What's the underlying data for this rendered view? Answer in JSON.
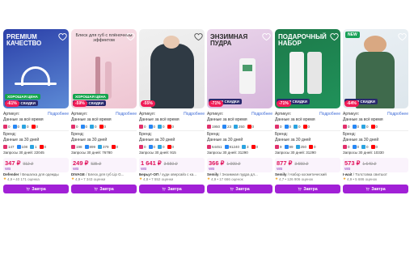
{
  "labels": {
    "article": "Артикул:",
    "more": "Подробнее",
    "all_time": "Данные за всё время",
    "brand": "Бренд:",
    "data30": "Данные за 30 дней",
    "buy": "Завтра"
  },
  "cards": [
    {
      "overlay": "PREMIUM КАЧЕСТВО",
      "discount": "-61%",
      "ribbons": [
        "ХОРОШАЯ ЦЕНА",
        "КИБЕР СКИДКИ"
      ],
      "stats_all": [
        "0",
        "0",
        "0",
        "0"
      ],
      "stats_30": [
        "147",
        "108",
        "1",
        "0"
      ],
      "requests": "Запросы 30 дней: 22045",
      "price": "347 ₽",
      "old_price": "912 ₽",
      "wb": "WB",
      "brand": "Defender",
      "name": "/ Вешалка для одежды",
      "rating": "4,9",
      "reviews": "• 40 171 оценка",
      "colors": [
        "#2b3fa8",
        "#5d8bd6"
      ]
    },
    {
      "overlay": "Блеск для губ с плёночным эффектом",
      "discount": "-59%",
      "ribbons": [
        "ХОРОШАЯ ЦЕНА",
        "КИБЕР СКИДКИ"
      ],
      "stats_all": [
        "0",
        "0",
        "0",
        "0"
      ],
      "stats_30": [
        "198",
        "899",
        "379",
        "0"
      ],
      "requests": "Запросы 30 дней: 76780",
      "price": "249 ₽",
      "old_price": "535 ₽",
      "wb": "WB",
      "brand": "DIVAGE",
      "name": "/ Блеск для губ Lip G...",
      "rating": "4,9",
      "reviews": "• 7 343 оценки",
      "colors": [
        "#f7dfe6",
        "#eec5d2"
      ]
    },
    {
      "overlay": "",
      "discount": "-55%",
      "ribbons": [],
      "stats_all": [
        "0",
        "0",
        "0",
        "0"
      ],
      "stats_30": [
        "0",
        "0",
        "0",
        "0"
      ],
      "requests": "Запросы 30 дней: 915",
      "price": "1 641 ₽",
      "old_price": "3 550 ₽",
      "wb": "WB",
      "brand": "Берьут-ОП",
      "name": "/ худи оверсайз с ка...",
      "rating": "4,8",
      "reviews": "• 7 552 оценки",
      "colors": [
        "#f0f0f0",
        "#e4e4e4"
      ]
    },
    {
      "overlay": "ЭНЗИМНАЯ ПУДРА",
      "discount": "-71%",
      "ribbons": [
        "КИБЕР СКИДКИ"
      ],
      "stats_all": [
        "1950",
        "23",
        "250",
        "0"
      ],
      "stats_30": [
        "64451",
        "91240",
        "3",
        "0"
      ],
      "requests": "Запросы 30 дней: 31290",
      "price": "366 ₽",
      "old_price": "1 000 ₽",
      "wb": "WB",
      "brand": "Semily",
      "name": "/ Энзимная пудра дл...",
      "rating": "4,9",
      "reviews": "• 17 666 оценок",
      "colors": [
        "#e9d4ea",
        "#d7b7dc"
      ]
    },
    {
      "overlay": "ПОДАРОЧНЫЙ НАБОР",
      "discount": "-71%",
      "ribbons": [
        "КИБЕР СКИДКИ"
      ],
      "stats_all": [
        "0",
        "0",
        "0",
        "0"
      ],
      "stats_30": [
        "9",
        "99",
        "250",
        "0"
      ],
      "requests": "Запросы 30 дней: 31290",
      "price": "877 ₽",
      "old_price": "3 550 ₽",
      "wb": "WB",
      "brand": "Semily",
      "name": "/ Набор косметический",
      "rating": "4,7",
      "reviews": "• 126 906 оценок",
      "colors": [
        "#1d7a4a",
        "#20925a"
      ]
    },
    {
      "overlay": "",
      "discount": "-64%",
      "ribbons": [
        "КИБЕР СКИДКИ"
      ],
      "stats_all": [
        "0",
        "0",
        "0",
        "0"
      ],
      "stats_30": [
        "0",
        "0",
        "0",
        "0"
      ],
      "requests": "Запросы 30 дней: 10330",
      "price": "573 ₽",
      "old_price": "1 640 ₽",
      "wb": "WB",
      "brand": "I-wait",
      "name": "/ Толстовка свитшот",
      "rating": "4,9",
      "reviews": "• 5 686 оценок",
      "colors": [
        "#eaf0f4",
        "#dde6ec"
      ]
    }
  ]
}
